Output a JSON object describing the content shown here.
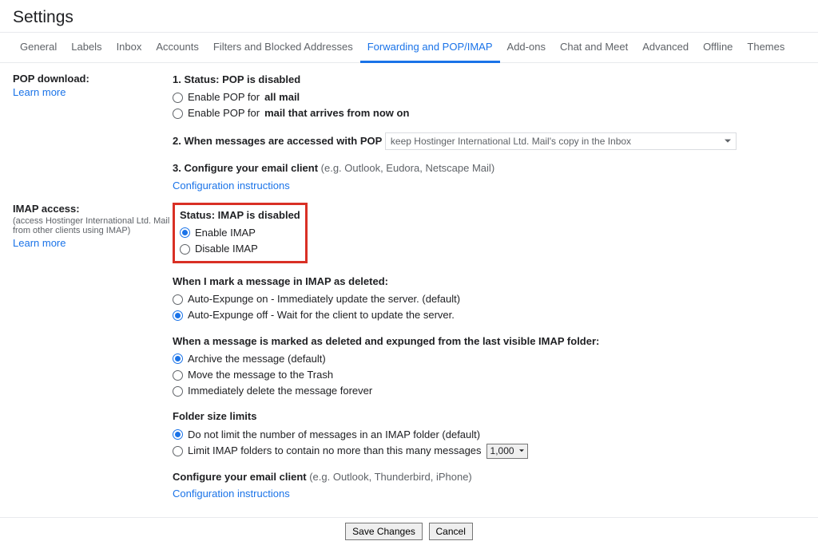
{
  "header": {
    "title": "Settings"
  },
  "tabs": [
    {
      "label": "General"
    },
    {
      "label": "Labels"
    },
    {
      "label": "Inbox"
    },
    {
      "label": "Accounts"
    },
    {
      "label": "Filters and Blocked Addresses"
    },
    {
      "label": "Forwarding and POP/IMAP",
      "active": true
    },
    {
      "label": "Add-ons"
    },
    {
      "label": "Chat and Meet"
    },
    {
      "label": "Advanced"
    },
    {
      "label": "Offline"
    },
    {
      "label": "Themes"
    }
  ],
  "pop": {
    "title": "POP download:",
    "learn_more": "Learn more",
    "status_prefix": "1. Status: ",
    "status_value": "POP is disabled",
    "opt1_prefix": "Enable POP for ",
    "opt1_bold": "all mail",
    "opt2_prefix": "Enable POP for ",
    "opt2_bold": "mail that arrives from now on",
    "access_label": "2. When messages are accessed with POP",
    "access_select": "keep Hostinger International Ltd. Mail's copy in the Inbox",
    "configure_prefix": "3. Configure your email client ",
    "configure_hint": "(e.g. Outlook, Eudora, Netscape Mail)",
    "config_link": "Configuration instructions"
  },
  "imap": {
    "title": "IMAP access:",
    "subtitle": "(access Hostinger International Ltd. Mail from other clients using IMAP)",
    "learn_more": "Learn more",
    "status": "Status: IMAP is disabled",
    "enable": "Enable IMAP",
    "disable": "Disable IMAP",
    "deleted_heading": "When I mark a message in IMAP as deleted:",
    "auto_on": "Auto-Expunge on - Immediately update the server. (default)",
    "auto_off": "Auto-Expunge off - Wait for the client to update the server.",
    "expunge_heading": "When a message is marked as deleted and expunged from the last visible IMAP folder:",
    "exp1": "Archive the message (default)",
    "exp2": "Move the message to the Trash",
    "exp3": "Immediately delete the message forever",
    "folder_heading": "Folder size limits",
    "folder1": "Do not limit the number of messages in an IMAP folder (default)",
    "folder2_prefix": "Limit IMAP folders to contain no more than this many messages",
    "folder2_select": "1,000",
    "configure_prefix": "Configure your email client ",
    "configure_hint": "(e.g. Outlook, Thunderbird, iPhone)",
    "config_link": "Configuration instructions"
  },
  "footer": {
    "save": "Save Changes",
    "cancel": "Cancel"
  }
}
